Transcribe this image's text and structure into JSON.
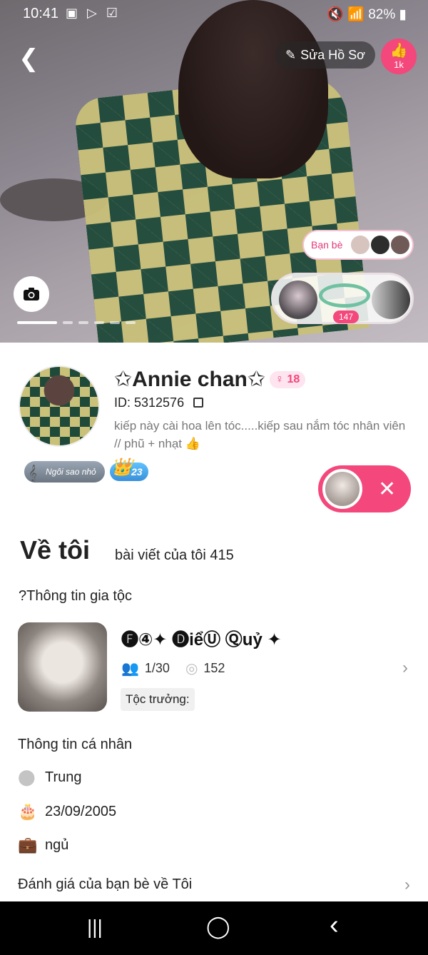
{
  "status_bar": {
    "time": "10:41",
    "left_icons": "▣ ▷ ☑",
    "right_text": "🔇 📶 82% ▮"
  },
  "cover": {
    "edit_label": "Sửa Hồ Sơ",
    "like_count": "1k",
    "friends_label": "Bạn bè",
    "gift_count": "147",
    "carousel": {
      "pages": 6,
      "active": 1
    }
  },
  "profile": {
    "name": "✩Annie chan✩",
    "gender_level": "18",
    "id_text": "ID: 5312576",
    "bio": "kiếp này cài hoa lên tóc.....kiếp sau nắm tóc nhân viên // phũ + nhạt 👍",
    "badge_star": "Ngôi sao nhỏ",
    "badge_level": "23"
  },
  "about": {
    "title": "Về tôi",
    "posts_link": "bài viết của tôi 415",
    "clan_title": "?Thông tin gia tộc",
    "clan": {
      "name": "🅕④✦ 🅓iểⓊ Ⓠuỷ ✦",
      "members": "1/30",
      "points": "152",
      "leader_label": "Tộc trưởng:"
    },
    "personal_title": "Thông tin cá nhân",
    "location": "Trung",
    "birthday": "23/09/2005",
    "job": "ngủ",
    "review_title": "Đánh giá của bạn bè về Tôi"
  },
  "colors": {
    "accent_pink": "#f4477b",
    "nav_bg": "#000000"
  },
  "navbar": {
    "recent": "|||",
    "home": "◯",
    "back": "‹"
  }
}
